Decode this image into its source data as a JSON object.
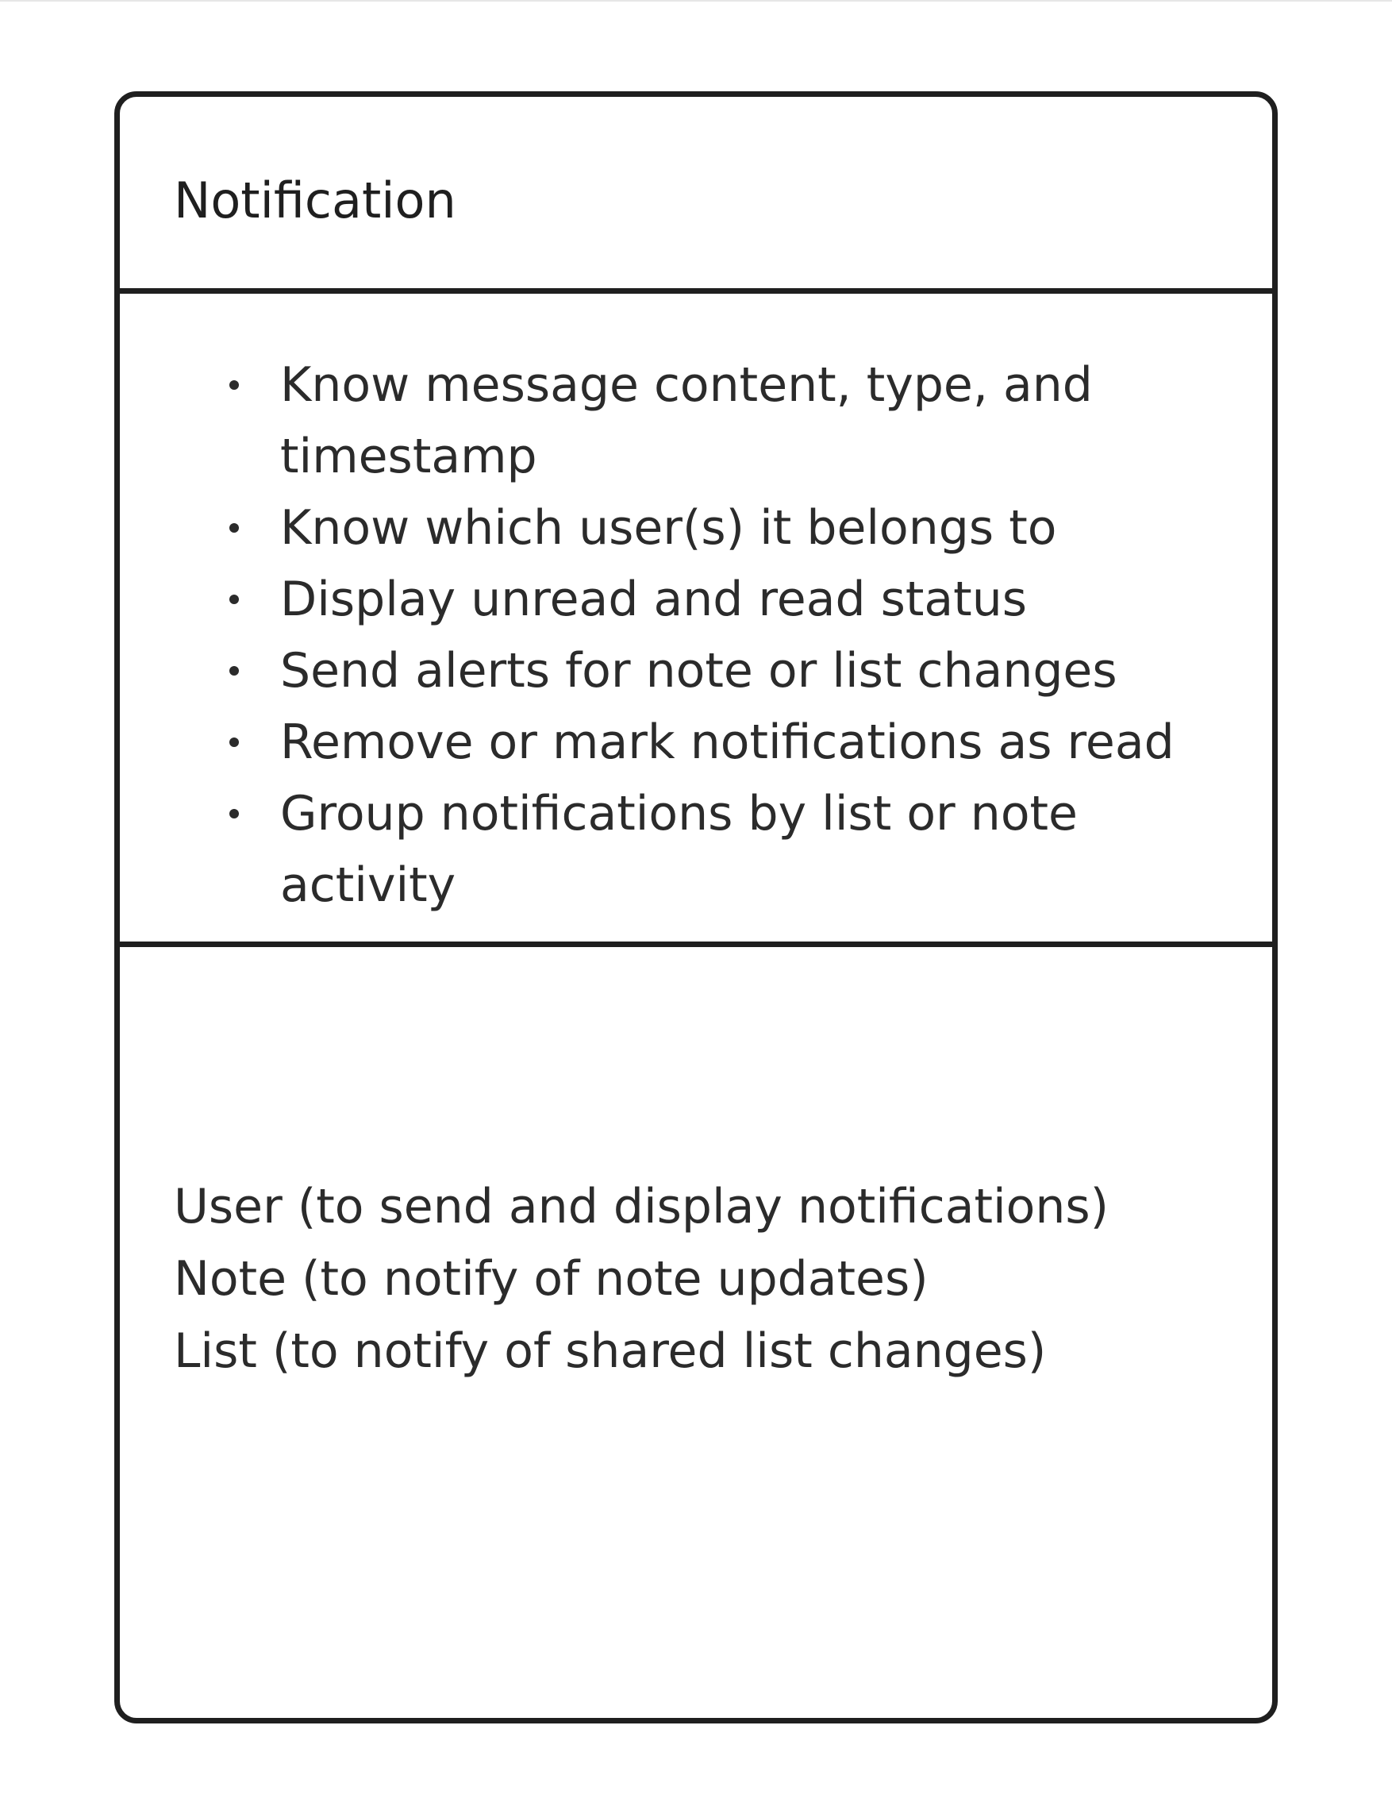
{
  "card": {
    "class_name": "Notification",
    "responsibilities": [
      "Know message content, type, and timestamp",
      "Know which user(s) it belongs to",
      "Display unread and read status",
      "Send alerts for note or list changes",
      "Remove or mark notifications as read",
      "Group notifications by list or note activity"
    ],
    "collaborators": [
      "User (to send and display notifications)",
      "Note (to notify of note updates)",
      "List (to notify of shared list changes)"
    ]
  },
  "colors": {
    "border": "#1f1f1f",
    "text": "#2b2b2b",
    "background": "#ffffff"
  }
}
